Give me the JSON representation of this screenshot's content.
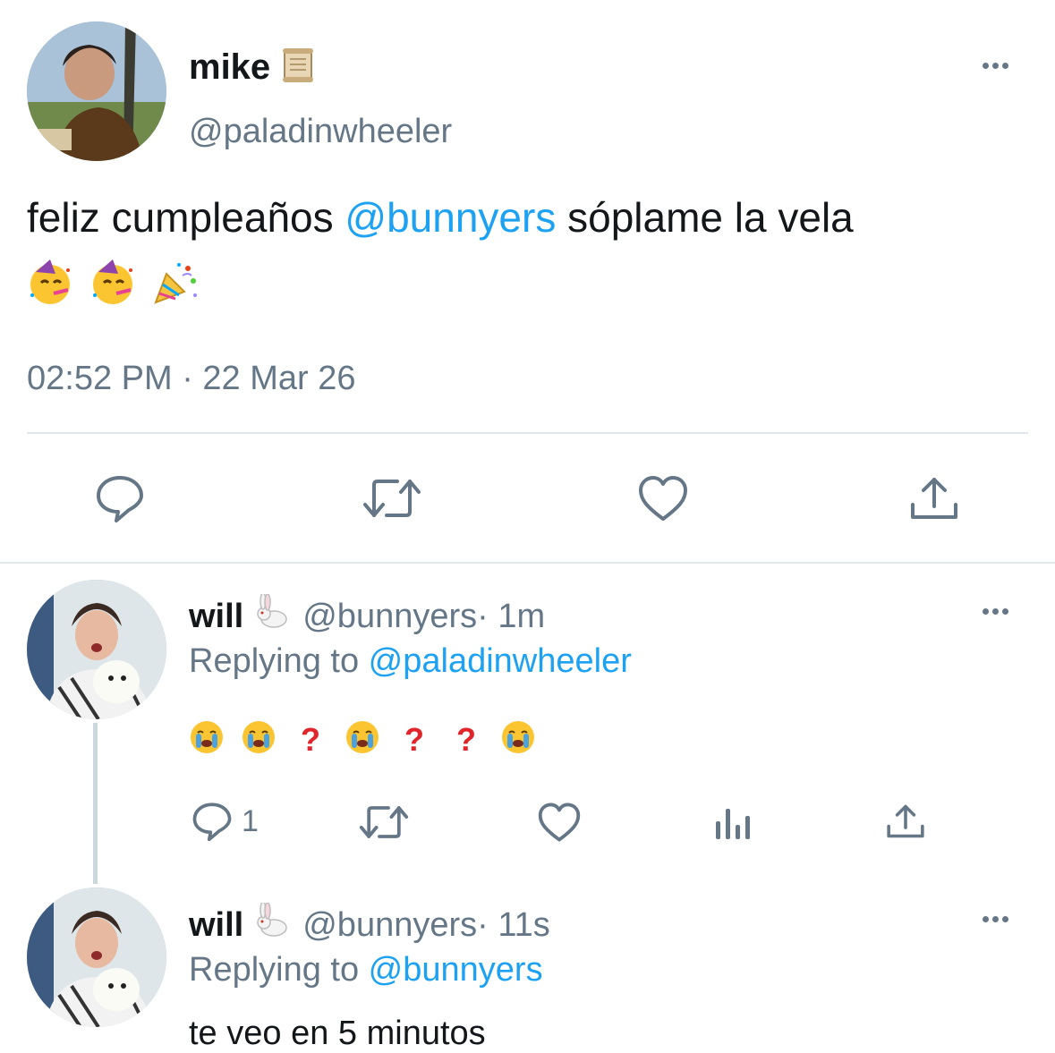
{
  "main_tweet": {
    "display_name": "mike",
    "name_emoji_icon": "scroll-icon",
    "handle": "@paladinwheeler",
    "text_before": "feliz cumpleaños ",
    "mention": "@bunnyers",
    "text_after": " sóplame la vela",
    "emojis": [
      "partying-face-icon",
      "partying-face-icon",
      "party-popper-icon"
    ],
    "timestamp": "02:52 PM · 22 Mar 26",
    "actions": [
      "reply-icon",
      "retweet-icon",
      "like-icon",
      "share-icon"
    ]
  },
  "reply1": {
    "display_name": "will",
    "name_emoji_icon": "rabbit-icon",
    "handle": "@bunnyers",
    "sep_time": " · 1m",
    "replying_prefix": "Replying to ",
    "replying_to": "@paladinwheeler",
    "emoji_sequence": [
      "crying-face-icon",
      "crying-face-icon",
      "question-mark-icon",
      "crying-face-icon",
      "question-mark-icon",
      "question-mark-icon",
      "crying-face-icon"
    ],
    "reply_count": "1",
    "actions": [
      "reply-icon",
      "retweet-icon",
      "like-icon",
      "analytics-icon",
      "share-icon"
    ]
  },
  "reply2": {
    "display_name": "will",
    "name_emoji_icon": "rabbit-icon",
    "handle": "@bunnyers",
    "sep_time": " · 11s",
    "replying_prefix": "Replying to ",
    "replying_to": "@bunnyers",
    "text": "te veo en 5 minutos"
  },
  "colors": {
    "accent": "#1da1f2",
    "secondary_text": "#657786",
    "primary_text": "#14171a",
    "divider": "#e1e8ed"
  }
}
